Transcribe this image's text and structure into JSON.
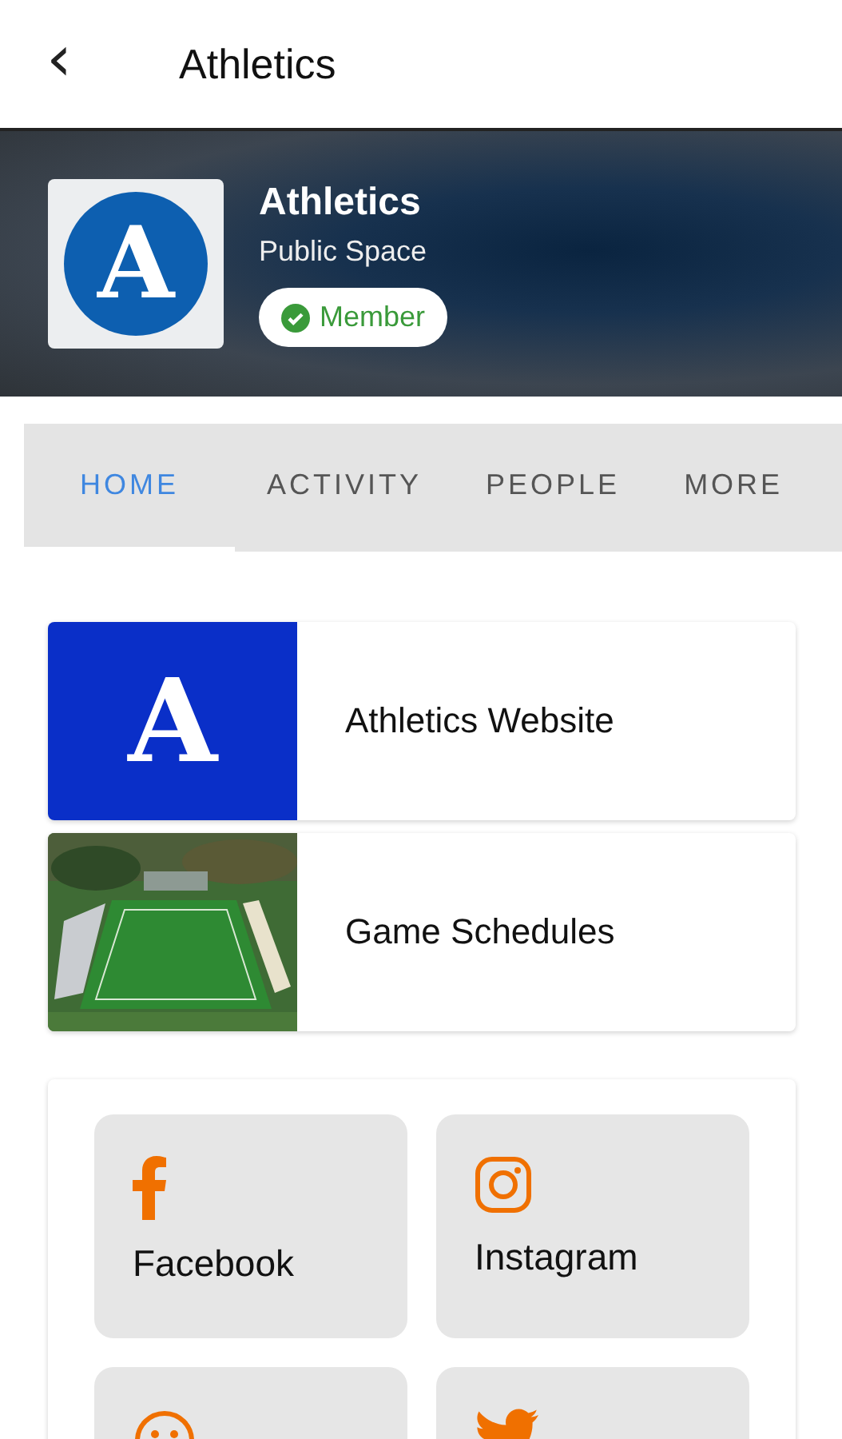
{
  "top_bar": {
    "back_icon": "‹",
    "title": "Athletics"
  },
  "space": {
    "logo_letter": "A",
    "name": "Athletics",
    "type": "Public Space",
    "member_badge": "Member"
  },
  "tabs": [
    {
      "label": "HOME",
      "selected": true
    },
    {
      "label": "ACTIVITY",
      "selected": false
    },
    {
      "label": "PEOPLE",
      "selected": false
    },
    {
      "label": "MORE",
      "selected": false
    }
  ],
  "links": [
    {
      "kind": "logo",
      "thumb_letter": "A",
      "label": "Athletics Website"
    },
    {
      "kind": "picture",
      "label": "Game Schedules"
    }
  ],
  "social": [
    {
      "kind": "facebook",
      "label": "Facebook"
    },
    {
      "kind": "instagram",
      "label": "Instagram"
    },
    {
      "kind": "smiley"
    },
    {
      "kind": "bird"
    }
  ]
}
